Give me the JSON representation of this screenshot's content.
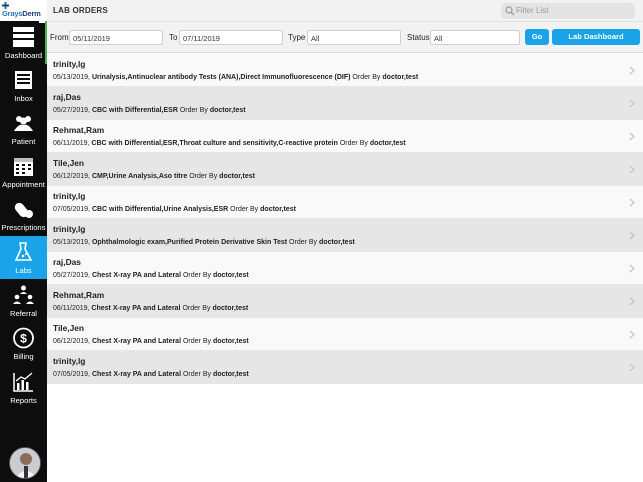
{
  "logo": {
    "brand_prefix": "Grays",
    "brand_suffix": "Derm"
  },
  "sidebar": {
    "items": [
      {
        "label": "Dashboard",
        "icon": "dashboard-icon",
        "active": false
      },
      {
        "label": "Inbox",
        "icon": "inbox-icon",
        "active": false
      },
      {
        "label": "Patient",
        "icon": "patient-icon",
        "active": false
      },
      {
        "label": "Appointment",
        "icon": "calendar-icon",
        "active": false
      },
      {
        "label": "Prescriptions",
        "icon": "pills-icon",
        "active": false
      },
      {
        "label": "Labs",
        "icon": "flask-icon",
        "active": true
      },
      {
        "label": "Referral",
        "icon": "referral-icon",
        "active": false
      },
      {
        "label": "Billing",
        "icon": "dollar-icon",
        "active": false
      },
      {
        "label": "Reports",
        "icon": "chart-icon",
        "active": false
      }
    ]
  },
  "header": {
    "title": "LAB ORDERS",
    "search_placeholder": "Filter List"
  },
  "filters": {
    "from_label": "From",
    "from_value": "05/11/2019",
    "to_label": "To",
    "to_value": "07/11/2019",
    "type_label": "Type",
    "type_value": "All",
    "status_label": "Status",
    "status_value": "All",
    "go_label": "Go",
    "dashboard_label": "Lab Dashboard"
  },
  "orders": [
    {
      "patient": "trinity,lg",
      "date": "05/13/2019,",
      "tests": "Urinalysis,Antinuclear antibody Tests (ANA),Direct Immunofluorescence (DIF)",
      "order_by": "Order By",
      "doctor": "doctor,test"
    },
    {
      "patient": "raj,Das",
      "date": "05/27/2019,",
      "tests": "CBC with Differential,ESR",
      "order_by": "Order By",
      "doctor": "doctor,test"
    },
    {
      "patient": "Rehmat,Ram",
      "date": "06/11/2019,",
      "tests": "CBC with Differential,ESR,Throat culture and sensitivity,C-reactive protein",
      "order_by": "Order By",
      "doctor": "doctor,test"
    },
    {
      "patient": "Tile,Jen",
      "date": "06/12/2019,",
      "tests": "CMP,Urine Analysis,Aso titre",
      "order_by": "Order By",
      "doctor": "doctor,test"
    },
    {
      "patient": "trinity,lg",
      "date": "07/05/2019,",
      "tests": "CBC with Differential,Urine Analysis,ESR",
      "order_by": "Order By",
      "doctor": "doctor,test"
    },
    {
      "patient": "trinity,lg",
      "date": "05/13/2019,",
      "tests": "Ophthalmologic exam,Purified Protein Derivative Skin Test",
      "order_by": "Order By",
      "doctor": "doctor,test"
    },
    {
      "patient": "raj,Das",
      "date": "05/27/2019,",
      "tests": "Chest X-ray PA and Lateral",
      "order_by": "Order By",
      "doctor": "doctor,test"
    },
    {
      "patient": "Rehmat,Ram",
      "date": "06/11/2019,",
      "tests": "Chest X-ray PA and Lateral",
      "order_by": "Order By",
      "doctor": "doctor,test"
    },
    {
      "patient": "Tile,Jen",
      "date": "06/12/2019,",
      "tests": "Chest X-ray PA and Lateral",
      "order_by": "Order By",
      "doctor": "doctor,test"
    },
    {
      "patient": "trinity,lg",
      "date": "07/05/2019,",
      "tests": "Chest X-ray PA and Lateral",
      "order_by": "Order By",
      "doctor": "doctor,test"
    }
  ],
  "colors": {
    "accent": "#1aa3e8",
    "sidebar": "#0d0d0d",
    "row_alt": "#e6e6e6",
    "row": "#f9f9f9"
  }
}
